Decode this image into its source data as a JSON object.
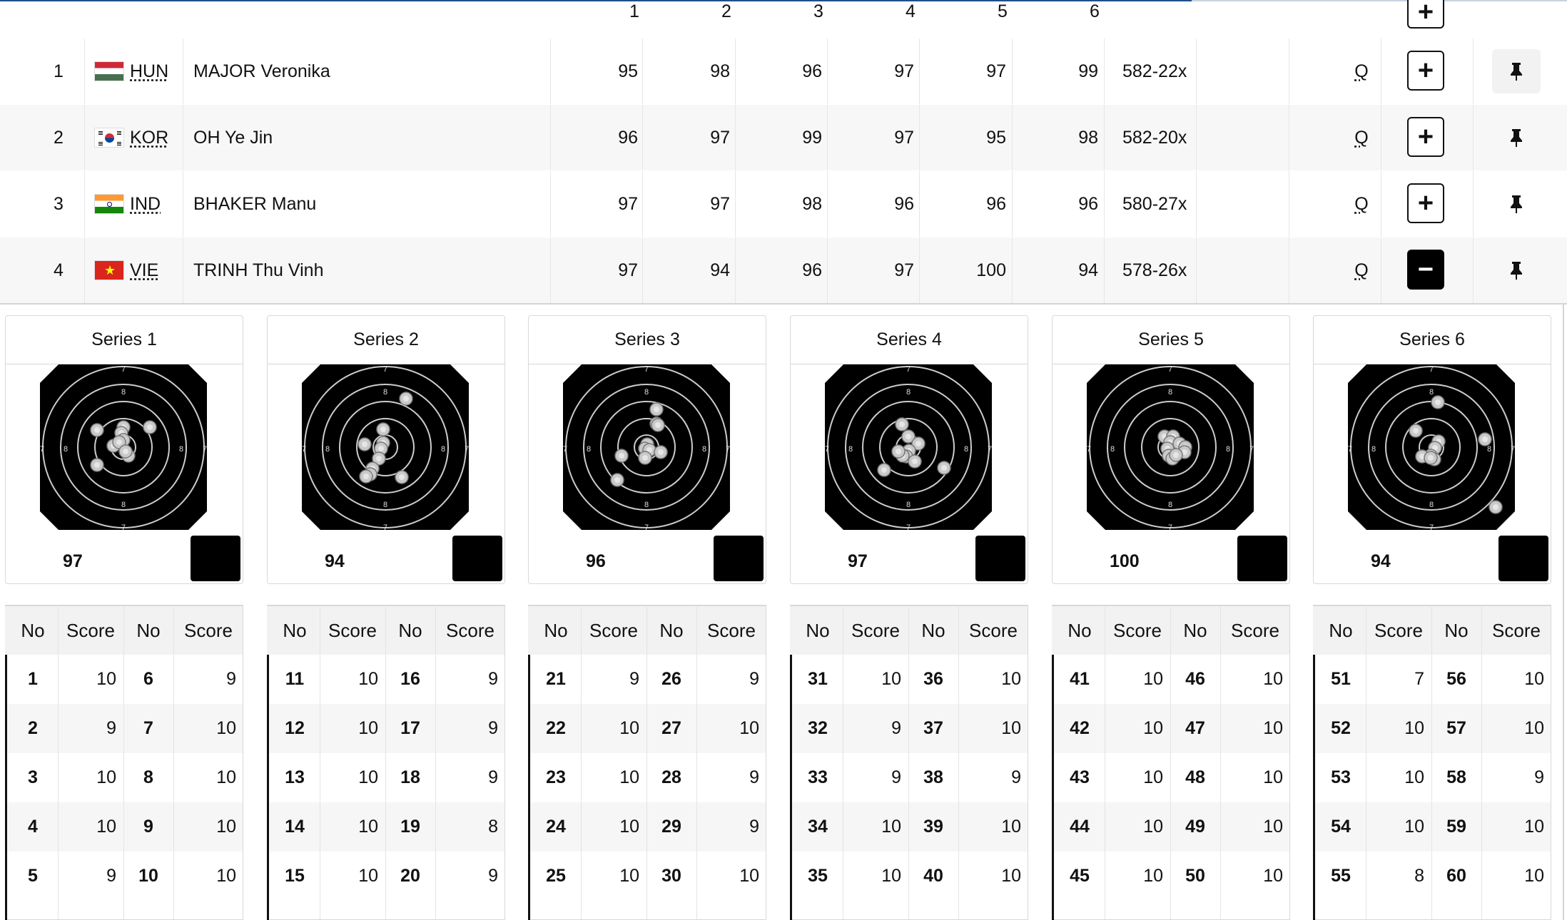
{
  "header": {
    "series_numbers": [
      "1",
      "2",
      "3",
      "4",
      "5",
      "6"
    ]
  },
  "athletes": [
    {
      "rank": "1",
      "noc": "HUN",
      "name": "MAJOR Veronika",
      "series": [
        "95",
        "98",
        "96",
        "97",
        "97",
        "99"
      ],
      "total": "582-22x",
      "qualified": "Q",
      "expand_state": "plus"
    },
    {
      "rank": "2",
      "noc": "KOR",
      "name": "OH Ye Jin",
      "series": [
        "96",
        "97",
        "99",
        "97",
        "95",
        "98"
      ],
      "total": "582-20x",
      "qualified": "Q",
      "expand_state": "plus"
    },
    {
      "rank": "3",
      "noc": "IND",
      "name": "BHAKER Manu",
      "series": [
        "97",
        "97",
        "98",
        "96",
        "96",
        "96"
      ],
      "total": "580-27x",
      "qualified": "Q",
      "expand_state": "plus"
    },
    {
      "rank": "4",
      "noc": "VIE",
      "name": "TRINH Thu Vinh",
      "series": [
        "97",
        "94",
        "96",
        "97",
        "100",
        "94"
      ],
      "total": "578-26x",
      "qualified": "Q",
      "expand_state": "minus"
    }
  ],
  "series_panels": [
    {
      "title": "Series 1",
      "score": "97"
    },
    {
      "title": "Series 2",
      "score": "94"
    },
    {
      "title": "Series 3",
      "score": "96"
    },
    {
      "title": "Series 4",
      "score": "97"
    },
    {
      "title": "Series 5",
      "score": "100"
    },
    {
      "title": "Series 6",
      "score": "94"
    }
  ],
  "target_ring_labels": {
    "outer": "7",
    "inner": "8"
  },
  "shot_table_headers": {
    "no": "No",
    "score": "Score"
  },
  "shot_tables": [
    {
      "rows": [
        [
          "1",
          "10",
          "6",
          "9"
        ],
        [
          "2",
          "9",
          "7",
          "10"
        ],
        [
          "3",
          "10",
          "8",
          "10"
        ],
        [
          "4",
          "10",
          "9",
          "10"
        ],
        [
          "5",
          "9",
          "10",
          "10"
        ]
      ]
    },
    {
      "rows": [
        [
          "11",
          "10",
          "16",
          "9"
        ],
        [
          "12",
          "10",
          "17",
          "9"
        ],
        [
          "13",
          "10",
          "18",
          "9"
        ],
        [
          "14",
          "10",
          "19",
          "8"
        ],
        [
          "15",
          "10",
          "20",
          "9"
        ]
      ]
    },
    {
      "rows": [
        [
          "21",
          "9",
          "26",
          "9"
        ],
        [
          "22",
          "10",
          "27",
          "10"
        ],
        [
          "23",
          "10",
          "28",
          "9"
        ],
        [
          "24",
          "10",
          "29",
          "9"
        ],
        [
          "25",
          "10",
          "30",
          "10"
        ]
      ]
    },
    {
      "rows": [
        [
          "31",
          "10",
          "36",
          "10"
        ],
        [
          "32",
          "9",
          "37",
          "10"
        ],
        [
          "33",
          "9",
          "38",
          "9"
        ],
        [
          "34",
          "10",
          "39",
          "10"
        ],
        [
          "35",
          "10",
          "40",
          "10"
        ]
      ]
    },
    {
      "rows": [
        [
          "41",
          "10",
          "46",
          "10"
        ],
        [
          "42",
          "10",
          "47",
          "10"
        ],
        [
          "43",
          "10",
          "48",
          "10"
        ],
        [
          "44",
          "10",
          "49",
          "10"
        ],
        [
          "45",
          "10",
          "50",
          "10"
        ]
      ]
    },
    {
      "rows": [
        [
          "51",
          "7",
          "56",
          "10"
        ],
        [
          "52",
          "10",
          "57",
          "10"
        ],
        [
          "53",
          "10",
          "58",
          "9"
        ],
        [
          "54",
          "10",
          "59",
          "10"
        ],
        [
          "55",
          "8",
          "60",
          "10"
        ]
      ]
    }
  ],
  "icons": {
    "expand_row": "plus-icon",
    "collapse_row": "minus-icon",
    "pin": "pin-icon",
    "fullscreen": "expand-arrows-icon"
  },
  "colors": {
    "row_alt": "#f7f7f7",
    "header_line": "#1f4f8a",
    "button_dark": "#000000"
  }
}
